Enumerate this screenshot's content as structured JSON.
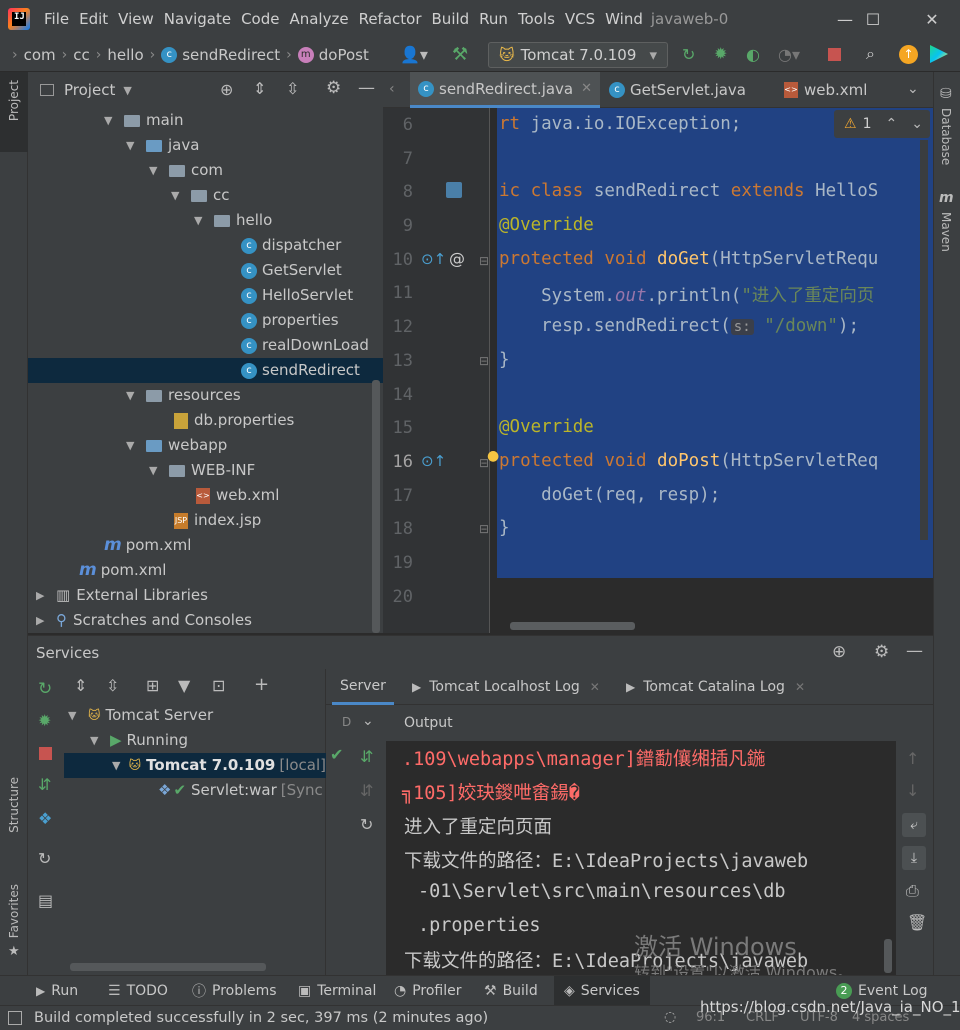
{
  "menubar": {
    "items": [
      "File",
      "Edit",
      "View",
      "Navigate",
      "Code",
      "Analyze",
      "Refactor",
      "Build",
      "Run",
      "Tools",
      "VCS",
      "Wind"
    ],
    "project_title": "javaweb-0"
  },
  "navbar": {
    "breadcrumbs": [
      "com",
      "cc",
      "hello",
      "sendRedirect",
      "doPost"
    ],
    "run_config": "Tomcat 7.0.109"
  },
  "left_stripe": {
    "project": "Project",
    "structure": "Structure",
    "favorites": "Favorites"
  },
  "right_stripe": {
    "database": "Database",
    "maven": "Maven"
  },
  "project_panel": {
    "title": "Project",
    "tree": [
      {
        "label": "main"
      },
      {
        "label": "java"
      },
      {
        "label": "com"
      },
      {
        "label": "cc"
      },
      {
        "label": "hello"
      },
      {
        "label": "dispatcher"
      },
      {
        "label": "GetServlet"
      },
      {
        "label": "HelloServlet"
      },
      {
        "label": "properties"
      },
      {
        "label": "realDownLoad"
      },
      {
        "label": "sendRedirect"
      },
      {
        "label": "resources"
      },
      {
        "label": "db.properties"
      },
      {
        "label": "webapp"
      },
      {
        "label": "WEB-INF"
      },
      {
        "label": "web.xml"
      },
      {
        "label": "index.jsp"
      },
      {
        "label": "pom.xml"
      },
      {
        "label": "pom.xml"
      },
      {
        "label": "External Libraries"
      },
      {
        "label": "Scratches and Consoles"
      }
    ]
  },
  "editor": {
    "tabs": [
      "sendRedirect.java",
      "GetServlet.java",
      "web.xml"
    ],
    "warning_count": "1",
    "line_numbers": [
      "6",
      "7",
      "8",
      "9",
      "10",
      "11",
      "12",
      "13",
      "14",
      "15",
      "16",
      "17",
      "18",
      "19",
      "20"
    ],
    "code": {
      "l6_kw": "rt ",
      "l6_rest": "java.io.IOException;",
      "l8_kw": "ic class ",
      "l8_name": "sendRedirect ",
      "l8_kw2": "extends ",
      "l8_rest": "HelloS",
      "l9": "@Override",
      "l10_kw": "protected void ",
      "l10_fn": "doGet",
      "l10_rest": "(HttpServletRequ",
      "l11_a": "    System.",
      "l11_fld": "out",
      "l11_b": ".println(",
      "l11_str": "\"进入了重定向页",
      "l12_a": "    resp.sendRedirect(",
      "l12_hint": "s:",
      "l12_str": " \"/down\"",
      "l12_b": ");",
      "l13": "}",
      "l15": "@Override",
      "l16_kw": "protected void ",
      "l16_fn": "doPost",
      "l16_rest": "(HttpServletReq",
      "l17": "    doGet(req, resp);",
      "l18": "}"
    }
  },
  "services": {
    "title": "Services",
    "tree": [
      {
        "label": "Tomcat Server"
      },
      {
        "label": "Running"
      },
      {
        "label": "Tomcat 7.0.109",
        "suffix": "[local]"
      },
      {
        "label": "Servlet:war",
        "suffix": "[Sync"
      }
    ],
    "tabs": [
      "Server",
      "Tomcat Localhost Log",
      "Tomcat Catalina Log"
    ],
    "output_label": "Output",
    "d_label": "D",
    "output_lines": [
      ".109\\webapps\\manager]鐠勫儴缃插凡鍦",
      "╗105]姣玦鍐呭畬鍚�",
      "进入了重定向页面",
      "下载文件的路径：E:\\IdeaProjects\\javaweb",
      "-01\\Servlet\\src\\main\\resources\\db",
      ".properties",
      "下载文件的路径：E:\\IdeaProjects\\javaweb"
    ],
    "watermark_1": "激活 Windows",
    "watermark_2": "转到\"设置\"以激活 Windows。"
  },
  "tool_tabs": {
    "run": "Run",
    "todo": "TODO",
    "problems": "Problems",
    "terminal": "Terminal",
    "profiler": "Profiler",
    "build": "Build",
    "services": "Services",
    "event_log_count": "2",
    "event_log": "Event Log"
  },
  "status_bar": {
    "message": "Build completed successfully in 2 sec, 397 ms (2 minutes ago)",
    "position": "96:1",
    "line_sep": "CRLF",
    "encoding": "UTF-8",
    "indent": "4 spaces",
    "url_watermark": "https://blog.csdn.net/Java_ia_NO_1"
  },
  "colors": {
    "accent": "#4a88c7",
    "selection": "#214283",
    "keyword": "#cc7832",
    "annotation": "#bbb529",
    "function": "#ffc66d",
    "string": "#6a8759",
    "error_output": "#ff6b68",
    "run_green": "#59a869",
    "stop_red": "#c75450"
  }
}
